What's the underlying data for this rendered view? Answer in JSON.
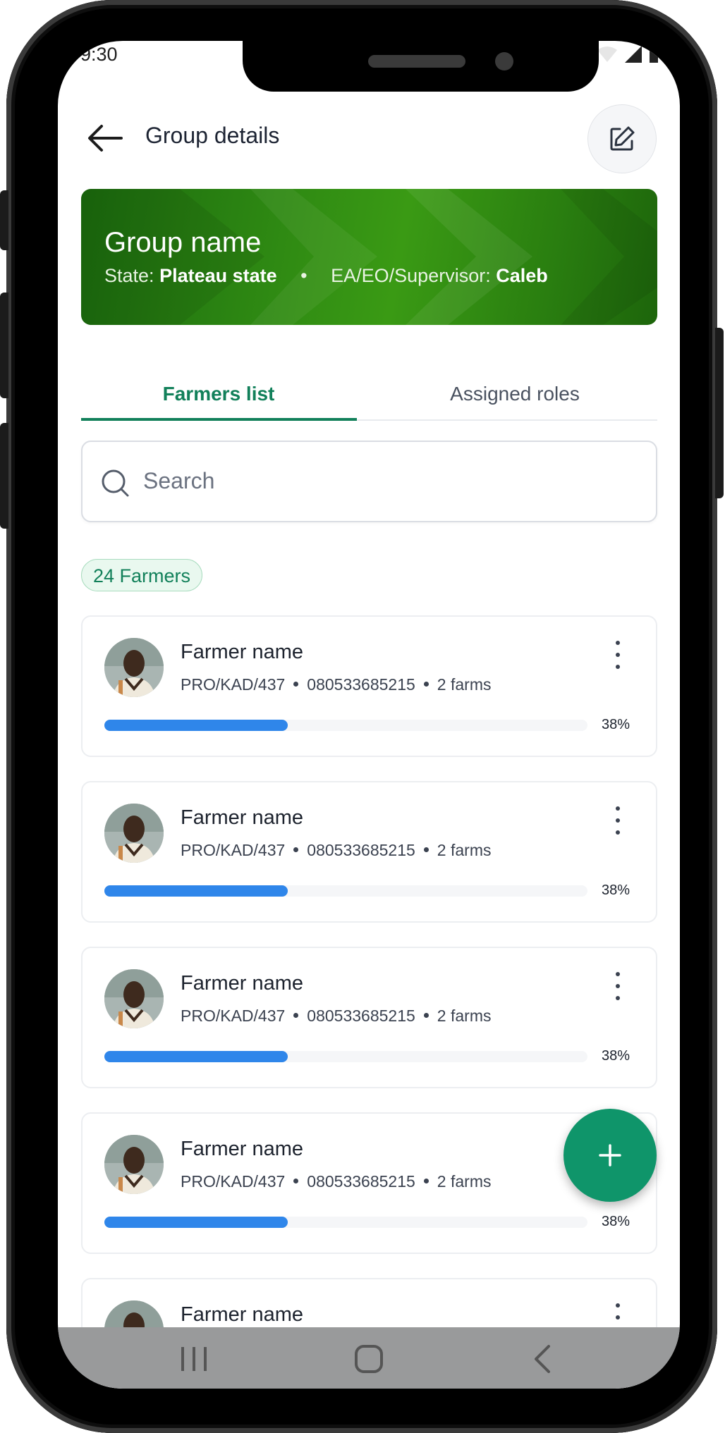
{
  "status_bar": {
    "time": "9:30"
  },
  "header": {
    "title": "Group details",
    "back_icon": "arrow-left-icon",
    "edit_icon": "pencil-edit-icon"
  },
  "group": {
    "name": "Group name",
    "state_label": "State:",
    "state_value": "Plateau state",
    "separator": "•",
    "supervisor_label": "EA/EO/Supervisor:",
    "supervisor_value": "Caleb"
  },
  "tabs": [
    {
      "label": "Farmers list",
      "active": true
    },
    {
      "label": "Assigned roles",
      "active": false
    }
  ],
  "search": {
    "placeholder": "Search",
    "value": ""
  },
  "farmer_count": "24 Farmers",
  "farmers": [
    {
      "name": "Farmer name",
      "id": "PRO/KAD/437",
      "phone": "080533685215",
      "farms": "2 farms",
      "progress": 0.38,
      "progress_label": "38%"
    },
    {
      "name": "Farmer name",
      "id": "PRO/KAD/437",
      "phone": "080533685215",
      "farms": "2 farms",
      "progress": 0.38,
      "progress_label": "38%"
    },
    {
      "name": "Farmer name",
      "id": "PRO/KAD/437",
      "phone": "080533685215",
      "farms": "2 farms",
      "progress": 0.38,
      "progress_label": "38%"
    },
    {
      "name": "Farmer name",
      "id": "PRO/KAD/437",
      "phone": "080533685215",
      "farms": "2 farms",
      "progress": 0.38,
      "progress_label": "38%"
    },
    {
      "name": "Farmer name"
    }
  ],
  "fab": {
    "icon": "plus-icon"
  },
  "nav_bar": {
    "icons": [
      "recent-apps-icon",
      "home-icon",
      "back-icon"
    ]
  },
  "colors": {
    "accent": "#12805a",
    "fab": "#0f956a",
    "progress": "#2f86ea",
    "banner": "#2f8a13"
  }
}
